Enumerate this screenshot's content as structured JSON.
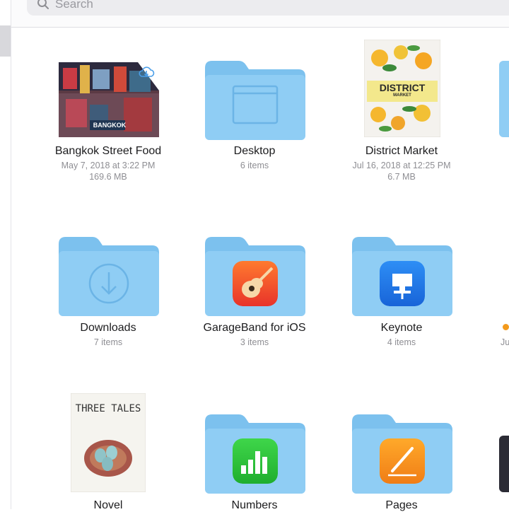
{
  "search": {
    "placeholder": "Search"
  },
  "items": [
    {
      "name": "Bangkok Street Food",
      "line1": "May 7, 2018 at 3:22 PM",
      "line2": "169.6 MB",
      "thumb_text": "BANGKOK"
    },
    {
      "name": "Desktop",
      "line1": "6 items"
    },
    {
      "name": "District Market",
      "line1": "Jul 16, 2018 at 12:25 PM",
      "line2": "6.7 MB",
      "thumb_title": "DISTRICT",
      "thumb_sub": "MARKET"
    },
    {
      "name": "Downloads",
      "line1": "7 items"
    },
    {
      "name": "GarageBand for iOS",
      "line1": "3 items"
    },
    {
      "name": "Keynote",
      "line1": "4 items"
    },
    {
      "name": "Novel",
      "thumb_title": "THREE TALES"
    },
    {
      "name": "Numbers"
    },
    {
      "name": "Pages"
    }
  ],
  "edge_partial_text": "Ju",
  "colors": {
    "folder": "#8fcdf4",
    "folder_tab": "#7cc1ee",
    "tag_orange": "#f39a1c"
  }
}
